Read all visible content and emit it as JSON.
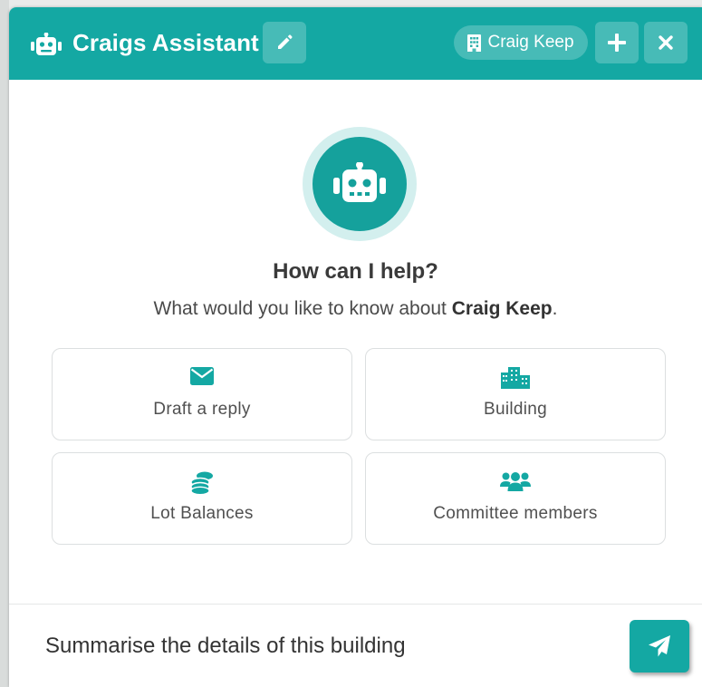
{
  "header": {
    "title": "Craigs Assistant",
    "building_name": "Craig Keep",
    "icons": {
      "bot": "robot-icon",
      "edit": "pencil-icon",
      "building": "building-icon",
      "add": "plus-icon",
      "close": "close-icon"
    }
  },
  "welcome": {
    "heading": "How can I help?",
    "subtitle_prefix": "What would you like to know about ",
    "subtitle_building": "Craig Keep",
    "subtitle_suffix": "."
  },
  "suggestions": [
    {
      "label": "Draft a reply",
      "icon": "envelope-icon"
    },
    {
      "label": "Building",
      "icon": "city-icon"
    },
    {
      "label": "Lot Balances",
      "icon": "coins-icon"
    },
    {
      "label": "Committee members",
      "icon": "users-icon"
    }
  ],
  "composer": {
    "value": "Summarise the details of this building",
    "send_icon": "paper-plane-icon"
  },
  "colors": {
    "accent": "#14a8a3",
    "accent_dark": "#15a19c",
    "avatar_ring": "#d3efee",
    "text": "#3a3a3a"
  }
}
